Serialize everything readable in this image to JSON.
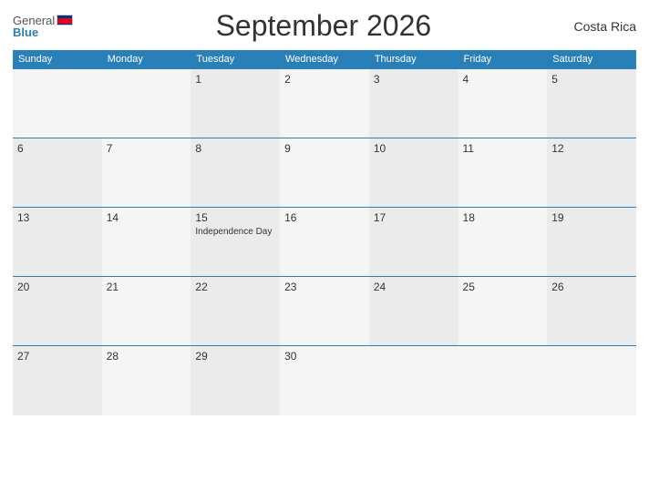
{
  "header": {
    "logo_general": "General",
    "logo_blue": "Blue",
    "title": "September 2026",
    "country": "Costa Rica"
  },
  "calendar": {
    "weekdays": [
      "Sunday",
      "Monday",
      "Tuesday",
      "Wednesday",
      "Thursday",
      "Friday",
      "Saturday"
    ],
    "weeks": [
      [
        {
          "day": "",
          "empty": true
        },
        {
          "day": "",
          "empty": true
        },
        {
          "day": "1"
        },
        {
          "day": "2"
        },
        {
          "day": "3"
        },
        {
          "day": "4"
        },
        {
          "day": "5"
        }
      ],
      [
        {
          "day": "6"
        },
        {
          "day": "7"
        },
        {
          "day": "8"
        },
        {
          "day": "9"
        },
        {
          "day": "10"
        },
        {
          "day": "11"
        },
        {
          "day": "12"
        }
      ],
      [
        {
          "day": "13"
        },
        {
          "day": "14"
        },
        {
          "day": "15",
          "holiday": "Independence Day"
        },
        {
          "day": "16"
        },
        {
          "day": "17"
        },
        {
          "day": "18"
        },
        {
          "day": "19"
        }
      ],
      [
        {
          "day": "20"
        },
        {
          "day": "21"
        },
        {
          "day": "22"
        },
        {
          "day": "23"
        },
        {
          "day": "24"
        },
        {
          "day": "25"
        },
        {
          "day": "26"
        }
      ],
      [
        {
          "day": "27"
        },
        {
          "day": "28"
        },
        {
          "day": "29"
        },
        {
          "day": "30"
        },
        {
          "day": "",
          "empty": true
        },
        {
          "day": "",
          "empty": true
        },
        {
          "day": "",
          "empty": true
        }
      ]
    ]
  }
}
